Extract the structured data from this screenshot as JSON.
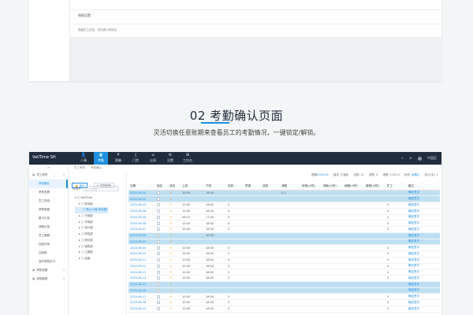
{
  "top_card": {
    "section_label": "隐匿设置",
    "section_desc": "隐藏员工信息，请先确认再保存"
  },
  "heading": {
    "number": "02",
    "title": "考勤确认页面",
    "subtitle": "灵活切换任意账期来查看员工的考勤情况，一键锁定/解锁。"
  },
  "app": {
    "brand": "VallTime SH",
    "nav": [
      {
        "icon": "user-icon",
        "glyph": "👤",
        "label": "人事"
      },
      {
        "icon": "calendar-icon",
        "glyph": "▦",
        "label": "考勤"
      },
      {
        "icon": "money-icon",
        "glyph": "¥",
        "label": "薪酬"
      },
      {
        "icon": "door-icon",
        "glyph": "▯",
        "label": "门禁"
      },
      {
        "icon": "share-icon",
        "glyph": "⌂",
        "label": "仪表"
      },
      {
        "icon": "gear-icon",
        "glyph": "⚙",
        "label": "设置"
      },
      {
        "icon": "grid-icon",
        "glyph": "⊞",
        "label": "工作台"
      }
    ],
    "topright": {
      "search": "⌕",
      "bell": "◔",
      "user": "中国区"
    },
    "sidebar": {
      "collapse": "≡",
      "items": [
        {
          "label": "员工考勤",
          "type": "group"
        },
        {
          "label": "考勤确认",
          "type": "item",
          "active": true
        },
        {
          "label": "考勤查看",
          "type": "item"
        },
        {
          "label": "员工排班",
          "type": "item"
        },
        {
          "label": "考勤明细",
          "type": "item"
        },
        {
          "label": "数卡记录",
          "type": "item"
        },
        {
          "label": "请假记录",
          "type": "item"
        },
        {
          "label": "员工假期",
          "type": "item"
        },
        {
          "label": "加班补休",
          "type": "item"
        },
        {
          "label": "加班规",
          "type": "item"
        },
        {
          "label": "及时考勤补卡",
          "type": "item"
        },
        {
          "label": "考勤设置",
          "type": "group"
        },
        {
          "label": "考勤报表",
          "type": "group"
        }
      ]
    },
    "breadcrumb": [
      "员工考勤",
      "考勤确认"
    ],
    "buttons": {
      "lock": "锁定",
      "unlock": "切换账期"
    },
    "search": {
      "label": "关键字",
      "placeholder": "工号/姓名"
    },
    "tree": [
      {
        "label": "▾ ▢ VallTime",
        "indent": 0
      },
      {
        "label": "▾ ▢ 财务部",
        "indent": 1
      },
      {
        "label": "▢ 默认小组(有权限)",
        "indent": 2,
        "selected": true
      },
      {
        "label": "▸ ▢ 行政部",
        "indent": 1
      },
      {
        "label": "▸ ▢ 市场部",
        "indent": 1
      },
      {
        "label": "▸ ▢ 设计部",
        "indent": 1
      },
      {
        "label": "▸ ▢ 研发部",
        "indent": 1
      },
      {
        "label": "▸ ▢ 测试部",
        "indent": 1
      },
      {
        "label": "▸ ▢ 销售部",
        "indent": 1
      },
      {
        "label": "▸ ▢ 工程部",
        "indent": 1
      },
      {
        "label": "▸ ▢ 运营",
        "indent": 1
      }
    ],
    "summary": {
      "period_label": "账期",
      "period": "2020-06",
      "lock_label": "锁定",
      "lock": "已锁定",
      "present_label": "出勤",
      "present": "21",
      "absent_label": "缺勤",
      "absent": "0",
      "leave_label": "请假",
      "leave": "0.5/1.0",
      "status_label": "状态",
      "status": "未确认",
      "total_label": "总计(天)",
      "total": "2"
    },
    "table": {
      "headers": [
        "日期",
        "锁定",
        "状态",
        "上班",
        "下班",
        "迟到",
        "早退",
        "加班",
        "请假",
        "年假(小时)",
        "调休(小时)",
        "病假(小时)",
        "事假(小时)",
        "旷工",
        "备注"
      ],
      "rows": [
        {
          "date": "2020-06-30",
          "hl": true,
          "lock": true,
          "icon": "☀",
          "on": "10:00",
          "off": "18:04",
          "late": "",
          "early": "",
          "ot": "",
          "leave": "0.1",
          "c1": "",
          "c2": "",
          "c3": "",
          "c4": "",
          "absent": "",
          "note": "确定签字"
        },
        {
          "date": "2020-06-02",
          "hl": true,
          "lock": true,
          "icon": "☀",
          "on": "",
          "off": "",
          "late": "",
          "early": "",
          "ot": "",
          "leave": "",
          "c1": "",
          "c2": "",
          "c3": "",
          "c4": "",
          "absent": "",
          "note": "确定签字"
        },
        {
          "date": "2020-06-29",
          "hl": false,
          "lock": false,
          "icon": "☀",
          "on": "10:00",
          "off": "18:00",
          "late": "0",
          "early": "",
          "ot": "",
          "leave": "",
          "c1": "",
          "c2": "",
          "c3": "",
          "c4": "",
          "absent": "0",
          "note": "确定签字"
        },
        {
          "date": "2020-06-28",
          "hl": false,
          "lock": false,
          "icon": "☀",
          "on": "10:00",
          "off": "18:00",
          "late": "0",
          "early": "",
          "ot": "",
          "leave": "",
          "c1": "",
          "c2": "",
          "c3": "",
          "c4": "",
          "absent": "0",
          "note": "确定签字"
        },
        {
          "date": "2020-06-26",
          "hl": false,
          "lock": false,
          "icon": "☀",
          "on": "08:10",
          "off": "17:00",
          "late": "0",
          "early": "",
          "ot": "",
          "leave": "",
          "c1": "",
          "c2": "",
          "c3": "",
          "c4": "",
          "absent": "0",
          "note": "确定签字"
        },
        {
          "date": "2020-06-08",
          "hl": false,
          "lock": false,
          "icon": "☀",
          "on": "10:00",
          "off": "18:00",
          "late": "0",
          "early": "",
          "ot": "",
          "leave": "",
          "c1": "",
          "c2": "",
          "c3": "",
          "c4": "",
          "absent": "0",
          "note": "确定签字"
        },
        {
          "date": "2020-06-07",
          "hl": false,
          "lock": false,
          "icon": "☀",
          "on": "10:00",
          "off": "18:00",
          "late": "0",
          "early": "",
          "ot": "",
          "leave": "",
          "c1": "",
          "c2": "",
          "c3": "",
          "c4": "",
          "absent": "0",
          "note": "确定签字"
        },
        {
          "date": "2020-06-06",
          "hl": true,
          "lock": true,
          "icon": "☀",
          "on": "",
          "off": "10:40",
          "late": "",
          "early": "",
          "ot": "",
          "leave": "",
          "c1": "",
          "c2": "",
          "c3": "",
          "c4": "",
          "absent": "",
          "note": "确定签字"
        },
        {
          "date": "2020-06-05",
          "hl": true,
          "lock": true,
          "icon": "☀",
          "on": "",
          "off": "",
          "late": "",
          "early": "",
          "ot": "",
          "leave": "",
          "c1": "",
          "c2": "",
          "c3": "",
          "c4": "",
          "absent": "",
          "note": "确定签字"
        },
        {
          "date": "2020-06-04",
          "hl": false,
          "lock": false,
          "icon": "☀",
          "on": "10:00",
          "off": "18:00",
          "late": "0",
          "early": "",
          "ot": "",
          "leave": "",
          "c1": "",
          "c2": "",
          "c3": "",
          "c4": "",
          "absent": "0",
          "note": "确定签字"
        },
        {
          "date": "2020-06-13",
          "hl": false,
          "lock": false,
          "icon": "☀",
          "on": "10:00",
          "off": "18:00",
          "late": "0",
          "early": "",
          "ot": "",
          "leave": "",
          "c1": "",
          "c2": "",
          "c3": "",
          "c4": "",
          "absent": "0",
          "note": "确定签字"
        },
        {
          "date": "2020-06-11",
          "hl": false,
          "lock": false,
          "icon": "☀",
          "on": "10:00",
          "off": "18:00",
          "late": "0",
          "early": "",
          "ot": "",
          "leave": "",
          "c1": "",
          "c2": "",
          "c3": "",
          "c4": "",
          "absent": "0",
          "note": "确定签字"
        },
        {
          "date": "2020-06-12",
          "hl": false,
          "lock": false,
          "icon": "☀",
          "on": "10:00",
          "off": "18:00",
          "late": "0",
          "early": "",
          "ot": "",
          "leave": "",
          "c1": "",
          "c2": "",
          "c3": "",
          "c4": "",
          "absent": "0",
          "note": "确定签字"
        },
        {
          "date": "2020-06-13",
          "hl": false,
          "lock": false,
          "icon": "☀",
          "on": "10:00",
          "off": "18:00",
          "late": "0",
          "early": "",
          "ot": "",
          "leave": "",
          "c1": "",
          "c2": "",
          "c3": "",
          "c4": "",
          "absent": "0",
          "note": "确定签字"
        },
        {
          "date": "2020-06-14",
          "hl": false,
          "lock": false,
          "icon": "☀",
          "on": "10:00",
          "off": "18:00",
          "late": "0",
          "early": "",
          "ot": "",
          "leave": "",
          "c1": "",
          "c2": "",
          "c3": "",
          "c4": "",
          "absent": "0",
          "note": "确定签字"
        },
        {
          "date": "2020-06-15",
          "hl": true,
          "lock": true,
          "icon": "☀",
          "on": "",
          "off": "",
          "late": "",
          "early": "",
          "ot": "",
          "leave": "",
          "c1": "",
          "c2": "",
          "c3": "",
          "c4": "",
          "absent": "",
          "note": "确定签字"
        },
        {
          "date": "2020-06-16",
          "hl": true,
          "lock": true,
          "icon": "☀",
          "on": "",
          "off": "",
          "late": "",
          "early": "",
          "ot": "",
          "leave": "",
          "c1": "",
          "c2": "",
          "c3": "",
          "c4": "",
          "absent": "",
          "note": "确定签字"
        },
        {
          "date": "2020-06-17",
          "hl": false,
          "lock": false,
          "icon": "☀",
          "on": "10:00",
          "off": "18:00",
          "late": "0",
          "early": "",
          "ot": "",
          "leave": "",
          "c1": "",
          "c2": "",
          "c3": "",
          "c4": "",
          "absent": "0",
          "note": "确定签字"
        },
        {
          "date": "2020-06-18",
          "hl": false,
          "lock": false,
          "icon": "☀",
          "on": "10:00",
          "off": "18:00",
          "late": "0",
          "early": "",
          "ot": "",
          "leave": "",
          "c1": "",
          "c2": "",
          "c3": "",
          "c4": "",
          "absent": "0",
          "note": "确定签字"
        },
        {
          "date": "2020-06-19",
          "hl": false,
          "lock": false,
          "icon": "☀",
          "on": "10:00",
          "off": "18:00",
          "late": "0",
          "early": "",
          "ot": "",
          "leave": "",
          "c1": "",
          "c2": "",
          "c3": "",
          "c4": "",
          "absent": "0",
          "note": "确定签字"
        }
      ]
    }
  },
  "colors": {
    "accent": "#1f8fe0",
    "topbar": "#1f2d3d",
    "highlight_row": "#bfe0f3"
  }
}
